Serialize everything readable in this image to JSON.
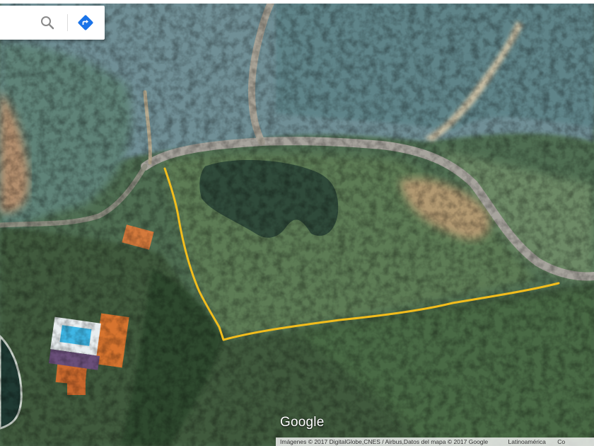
{
  "map": {
    "type": "satellite",
    "colors": {
      "boundary_line": "#f2bd1d",
      "road": "#a7a49d"
    }
  },
  "search": {
    "value": "",
    "placeholder": "",
    "search_icon": "search-icon",
    "directions_icon": "directions-icon"
  },
  "branding": {
    "logo": "Google"
  },
  "attribution": {
    "text": "Imágenes © 2017 DigitalGlobe,CNES / Airbus,Datos del mapa © 2017 Google",
    "terms": "Latinoamérica",
    "more": "Co"
  }
}
